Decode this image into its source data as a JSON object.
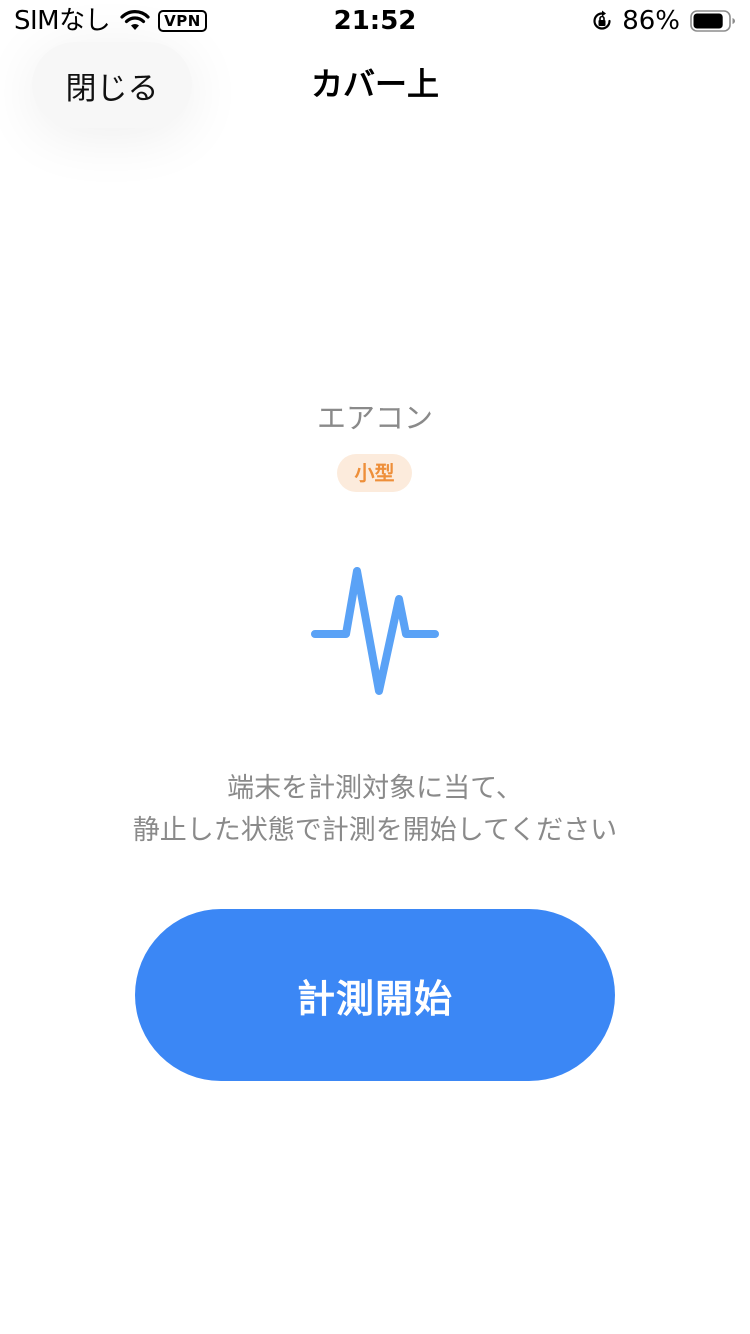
{
  "status_bar": {
    "carrier": "SIMなし",
    "vpn": "VPN",
    "time": "21:52",
    "battery_percent": "86%",
    "battery_level": 0.86,
    "icons": [
      "wifi-icon",
      "rotation-lock-icon",
      "battery-icon"
    ]
  },
  "nav": {
    "close_label": "閉じる",
    "title": "カバー上"
  },
  "content": {
    "device_name": "エアコン",
    "size_badge": "小型",
    "pulse_icon": "pulse-icon",
    "instruction_line1": "端末を計測対象に当て、",
    "instruction_line2": "静止した状態で計測を開始してください",
    "start_button_label": "計測開始"
  },
  "colors": {
    "accent_blue": "#3b87f5",
    "pulse_blue": "#5aa2f6",
    "badge_bg": "#fcebdc",
    "badge_text": "#ee8f3a",
    "muted_text": "#8a8a8a"
  }
}
